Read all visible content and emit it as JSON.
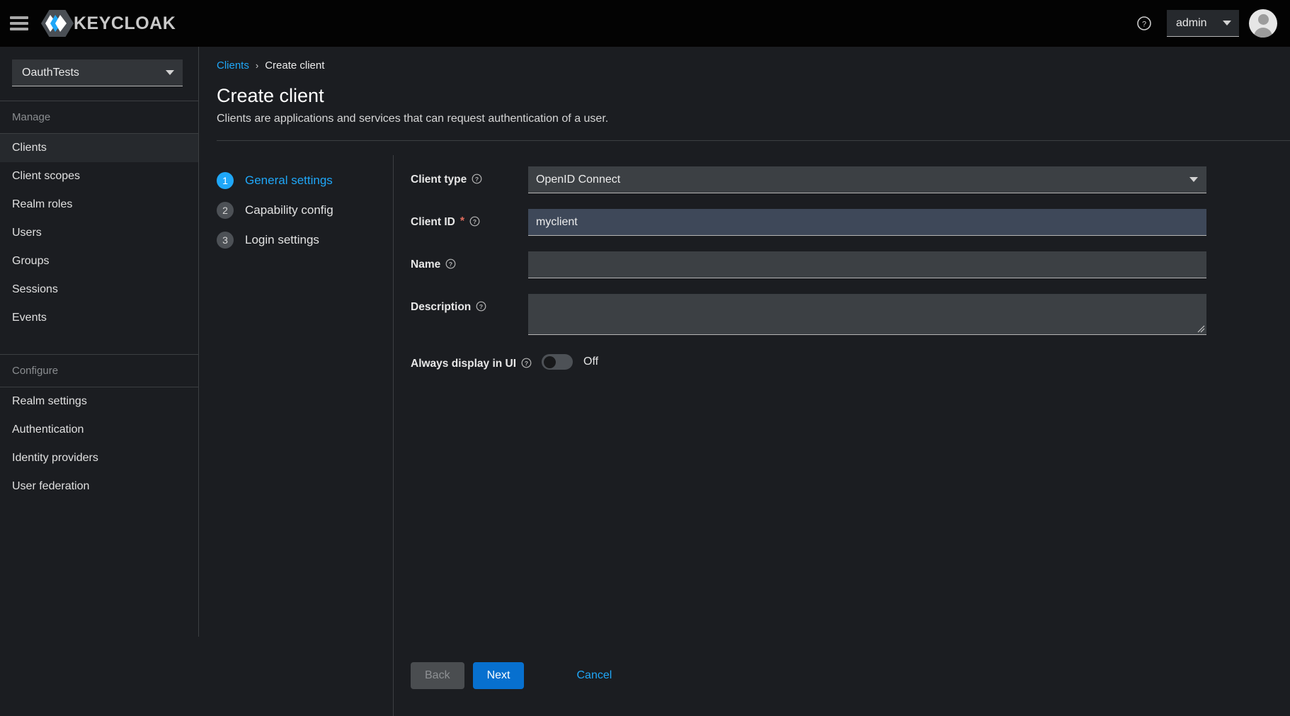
{
  "masthead": {
    "menu_icon": "hamburger-icon",
    "brand_name": "KEYCLOAK",
    "help_icon": "question-circle-icon",
    "user_name": "admin",
    "avatar_icon": "user-avatar-icon"
  },
  "sidebar": {
    "realm_selector": {
      "value": "OauthTests"
    },
    "groups": [
      {
        "title": "Manage",
        "items": [
          {
            "label": "Clients",
            "active": true
          },
          {
            "label": "Client scopes",
            "active": false
          },
          {
            "label": "Realm roles",
            "active": false
          },
          {
            "label": "Users",
            "active": false
          },
          {
            "label": "Groups",
            "active": false
          },
          {
            "label": "Sessions",
            "active": false
          },
          {
            "label": "Events",
            "active": false
          }
        ]
      },
      {
        "title": "Configure",
        "items": [
          {
            "label": "Realm settings",
            "active": false
          },
          {
            "label": "Authentication",
            "active": false
          },
          {
            "label": "Identity providers",
            "active": false
          },
          {
            "label": "User federation",
            "active": false
          }
        ]
      }
    ]
  },
  "page": {
    "breadcrumb": {
      "parent": "Clients",
      "separator": "›",
      "current": "Create client"
    },
    "title": "Create client",
    "subtitle": "Clients are applications and services that can request authentication of a user."
  },
  "wizard": {
    "steps": [
      {
        "num": "1",
        "label": "General settings",
        "active": true
      },
      {
        "num": "2",
        "label": "Capability config",
        "active": false
      },
      {
        "num": "3",
        "label": "Login settings",
        "active": false
      }
    ]
  },
  "form": {
    "client_type": {
      "label": "Client type",
      "value": "OpenID Connect",
      "help_icon": "question-circle-icon"
    },
    "client_id": {
      "label": "Client ID",
      "required_marker": "*",
      "value": "myclient",
      "placeholder": "",
      "help_icon": "question-circle-icon"
    },
    "name": {
      "label": "Name",
      "value": "",
      "placeholder": "",
      "help_icon": "question-circle-icon"
    },
    "description": {
      "label": "Description",
      "value": "",
      "placeholder": "",
      "help_icon": "question-circle-icon"
    },
    "always_display": {
      "label": "Always display in UI",
      "state_text": "Off",
      "help_icon": "question-circle-icon"
    }
  },
  "footer": {
    "back_label": "Back",
    "next_label": "Next",
    "cancel_label": "Cancel"
  },
  "colors": {
    "accent_blue": "#1fa7f8",
    "primary_button": "#0770cf",
    "required_red": "#e06c5d",
    "masthead_bg": "#030303",
    "page_bg": "#1b1d21",
    "field_bg": "#3c4044",
    "field_focus_bg": "#3e4859"
  }
}
